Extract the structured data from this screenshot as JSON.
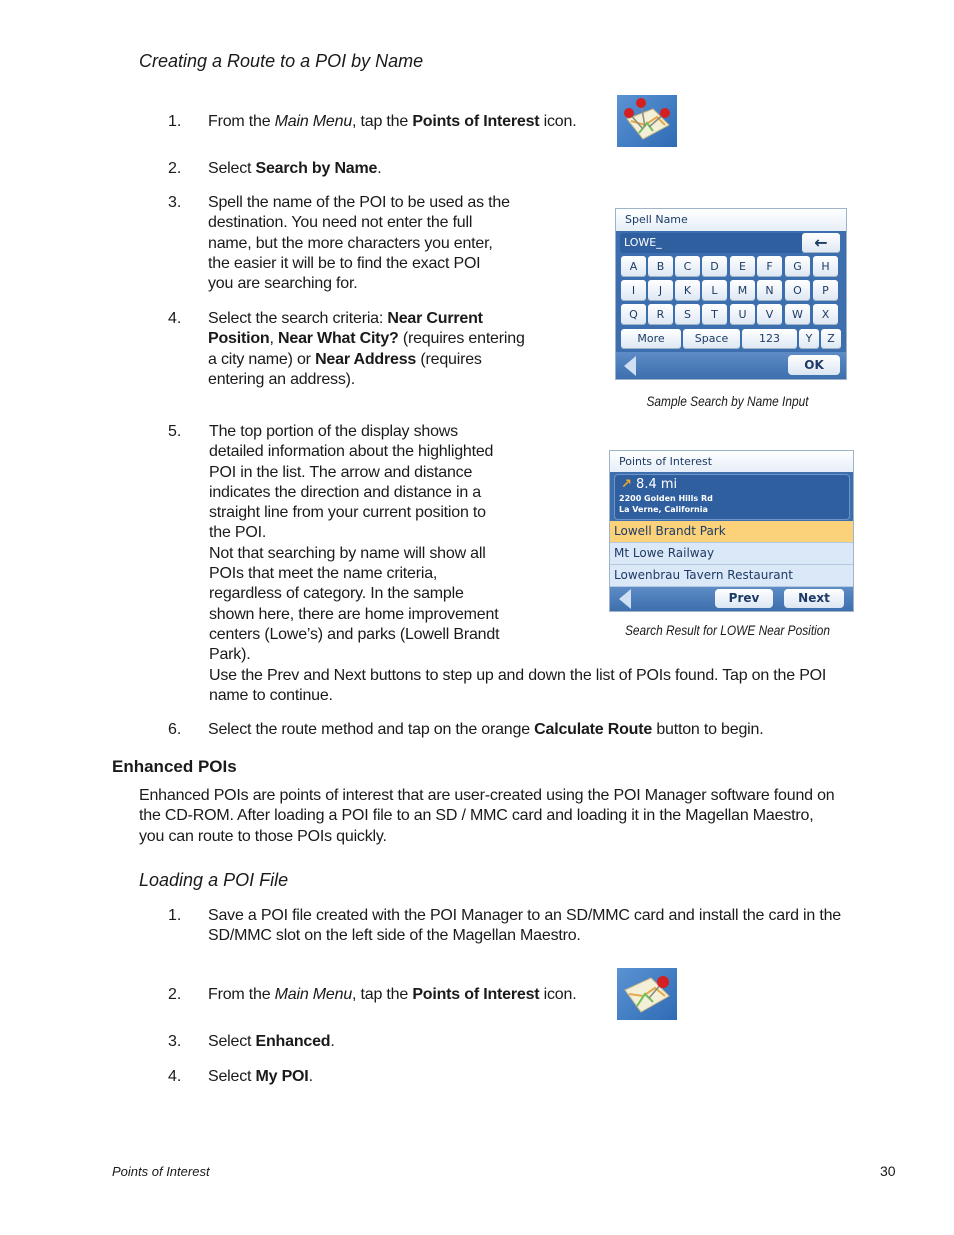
{
  "section1": {
    "heading": "Creating a Route to a POI by Name",
    "steps": [
      {
        "num": "1.",
        "pre": "From the ",
        "it": "Main Menu",
        "mid": ", tap the ",
        "bold": "Points of Interest",
        "post": " icon."
      },
      {
        "num": "2.",
        "pre": "Select ",
        "bold": "Search by Name",
        "post": "."
      },
      {
        "num": "3.",
        "lines": [
          "Spell the name of the POI to be used as the",
          "destination.  You need not enter the full",
          "name, but the more characters you enter,",
          "the easier it will be to find the exact POI",
          "you are searching for."
        ]
      },
      {
        "num": "4.",
        "line1_pre": "Select the search criteria: ",
        "line1_bold": "Near Current",
        "line2_bold1": "Position",
        "line2_sep": ", ",
        "line2_bold2": "Near What City?",
        "line2_post": " (requires entering",
        "line3_pre": "a city name) or ",
        "line3_bold": "Near Address",
        "line3_post": " (requires",
        "line4": "entering an address)."
      },
      {
        "num": "5.",
        "lines": [
          "The top portion of the display shows",
          "detailed information about the highlighted",
          "POI in the list.  The arrow and distance",
          "indicates the direction and distance in a",
          "straight line from your current position to",
          "the POI.",
          "Not that searching by name will show all",
          "POIs that meet the name criteria,",
          "regardless of category.  In the sample",
          "shown here, there are home improvement",
          "centers (Lowe’s) and parks (Lowell Brandt",
          "Park)."
        ],
        "wide_lines": [
          "Use the Prev and Next buttons to step up and down the list of POIs found.  Tap on the POI",
          "name to continue."
        ]
      },
      {
        "num": "6.",
        "pre": "Select the route method and tap on the orange ",
        "bold": "Calculate Route",
        "post": " button to begin."
      }
    ]
  },
  "spell_screen": {
    "title": "Spell Name",
    "input_value": "LOWE_",
    "backspace_icon": "left-arrow",
    "rows": [
      [
        "A",
        "B",
        "C",
        "D",
        "E",
        "F",
        "G",
        "H"
      ],
      [
        "I",
        "J",
        "K",
        "L",
        "M",
        "N",
        "O",
        "P"
      ],
      [
        "Q",
        "R",
        "S",
        "T",
        "U",
        "V",
        "W",
        "X"
      ]
    ],
    "last_row": {
      "more": "More",
      "space": "Space",
      "num": "123",
      "y": "Y",
      "z": "Z"
    },
    "ok": "OK",
    "caption": "Sample Search by Name Input"
  },
  "result_screen": {
    "title": "Points of Interest",
    "distance": "8.4 mi",
    "address1": "2200 Golden Hills Rd",
    "address2": "La Verne, California",
    "items": [
      "Lowell Brandt Park",
      "Mt Lowe Railway",
      "Lowenbrau Tavern Restaurant"
    ],
    "selected_index": 0,
    "prev": "Prev",
    "next": "Next",
    "caption": "Search Result for LOWE Near Position",
    "highlight_color": "#fbd27a"
  },
  "section2": {
    "heading": "Enhanced POIs",
    "para": [
      "Enhanced POIs are points of interest that are user-created using the POI Manager software found on",
      "the CD-ROM.  After loading a POI file to an SD / MMC card and loading it in the Magellan Maestro,",
      "you can route to those POIs quickly."
    ]
  },
  "section3": {
    "heading": "Loading a POI File",
    "steps": [
      {
        "num": "1.",
        "lines": [
          "Save a POI file created with the POI Manager to an SD/MMC card and install the card in the",
          "SD/MMC slot on the left side of the Magellan Maestro."
        ]
      },
      {
        "num": "2.",
        "pre": "From the ",
        "it": "Main Menu",
        "mid": ", tap the ",
        "bold": "Points of Interest",
        "post": " icon."
      },
      {
        "num": "3.",
        "pre": "Select ",
        "bold": "Enhanced",
        "post": "."
      },
      {
        "num": "4.",
        "pre": "Select ",
        "bold": "My POI",
        "post": "."
      }
    ]
  },
  "footer": {
    "left": "Points of Interest",
    "page": "30"
  }
}
